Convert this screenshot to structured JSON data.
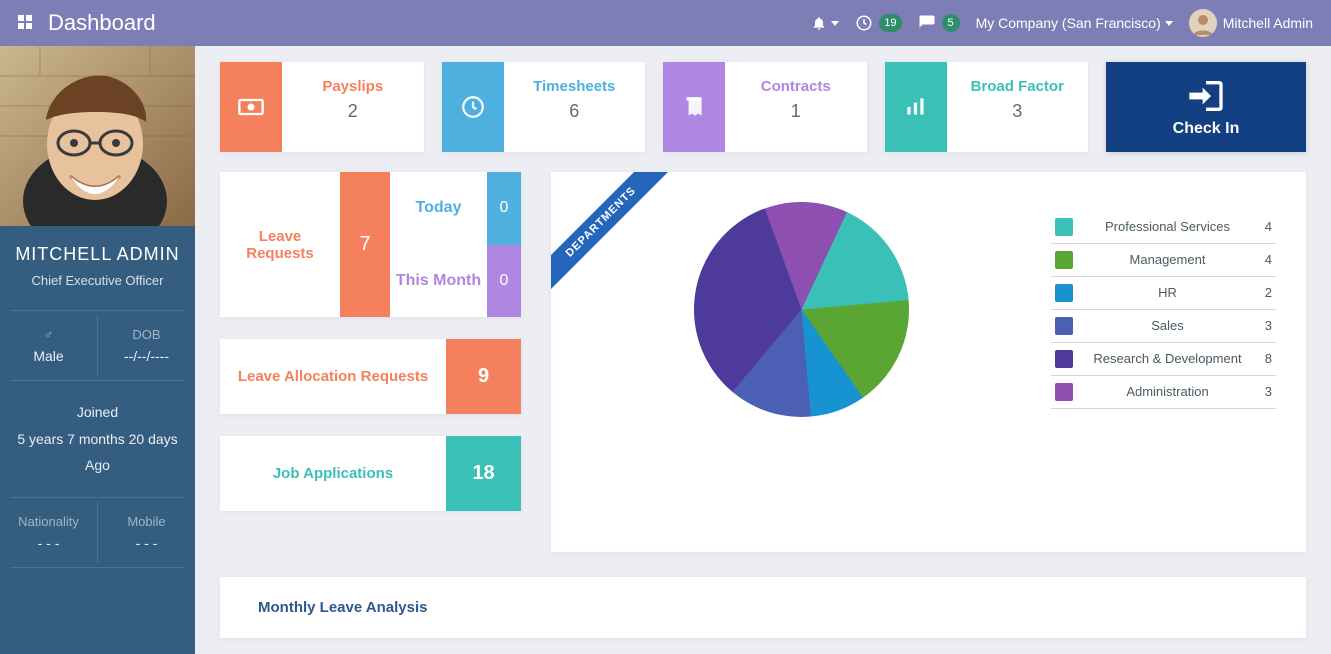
{
  "header": {
    "brand": "Dashboard",
    "notifications_badge": "19",
    "messages_badge": "5",
    "company": "My Company (San Francisco)",
    "user": "Mitchell Admin"
  },
  "profile": {
    "name": "MITCHELL ADMIN",
    "role": "Chief Executive Officer",
    "gender_label": "Male",
    "gender_symbol": "♂",
    "dob_label": "DOB",
    "dob_value": "--/--/----",
    "joined_label": "Joined",
    "joined_value": "5 years 7 months 20 days",
    "joined_suffix": "Ago",
    "nationality_label": "Nationality",
    "nationality_value": "- - -",
    "mobile_label": "Mobile",
    "mobile_value": "- - -"
  },
  "metrics": {
    "payslips": {
      "label": "Payslips",
      "value": "2",
      "color": "#f4805d"
    },
    "timesheets": {
      "label": "Timesheets",
      "value": "6",
      "color": "#4eb0df"
    },
    "contracts": {
      "label": "Contracts",
      "value": "1",
      "color": "#b086e3"
    },
    "broad_factor": {
      "label": "Broad Factor",
      "value": "3",
      "color": "#3ac0b6"
    }
  },
  "checkin_label": "Check In",
  "leave": {
    "label": "Leave Requests",
    "total": "7",
    "today_label": "Today",
    "today_value": "0",
    "month_label": "This Month",
    "month_value": "0"
  },
  "alloc": {
    "label": "Leave Allocation Requests",
    "value": "9",
    "bg": "#f4805d",
    "fg": "#f4805d"
  },
  "jobs": {
    "label": "Job Applications",
    "value": "18",
    "bg": "#3ac0b6",
    "fg": "#3ac0b6"
  },
  "dept": {
    "ribbon": "DEPARTMENTS",
    "items": [
      {
        "name": "Professional Services",
        "value": "4",
        "color": "#3ac0b6"
      },
      {
        "name": "Management",
        "value": "4",
        "color": "#5aa534"
      },
      {
        "name": "HR",
        "value": "2",
        "color": "#1793d1"
      },
      {
        "name": "Sales",
        "value": "3",
        "color": "#4b60b4"
      },
      {
        "name": "Research & Development",
        "value": "8",
        "color": "#4e3a9a"
      },
      {
        "name": "Administration",
        "value": "3",
        "color": "#8d4fb0"
      }
    ]
  },
  "analysis_title": "Monthly Leave Analysis",
  "chart_data": {
    "type": "pie",
    "title": "DEPARTMENTS",
    "series": [
      {
        "name": "Professional Services",
        "value": 4,
        "color": "#3ac0b6"
      },
      {
        "name": "Management",
        "value": 4,
        "color": "#5aa534"
      },
      {
        "name": "HR",
        "value": 2,
        "color": "#1793d1"
      },
      {
        "name": "Sales",
        "value": 3,
        "color": "#4b60b4"
      },
      {
        "name": "Research & Development",
        "value": 8,
        "color": "#4e3a9a"
      },
      {
        "name": "Administration",
        "value": 3,
        "color": "#8d4fb0"
      }
    ]
  }
}
